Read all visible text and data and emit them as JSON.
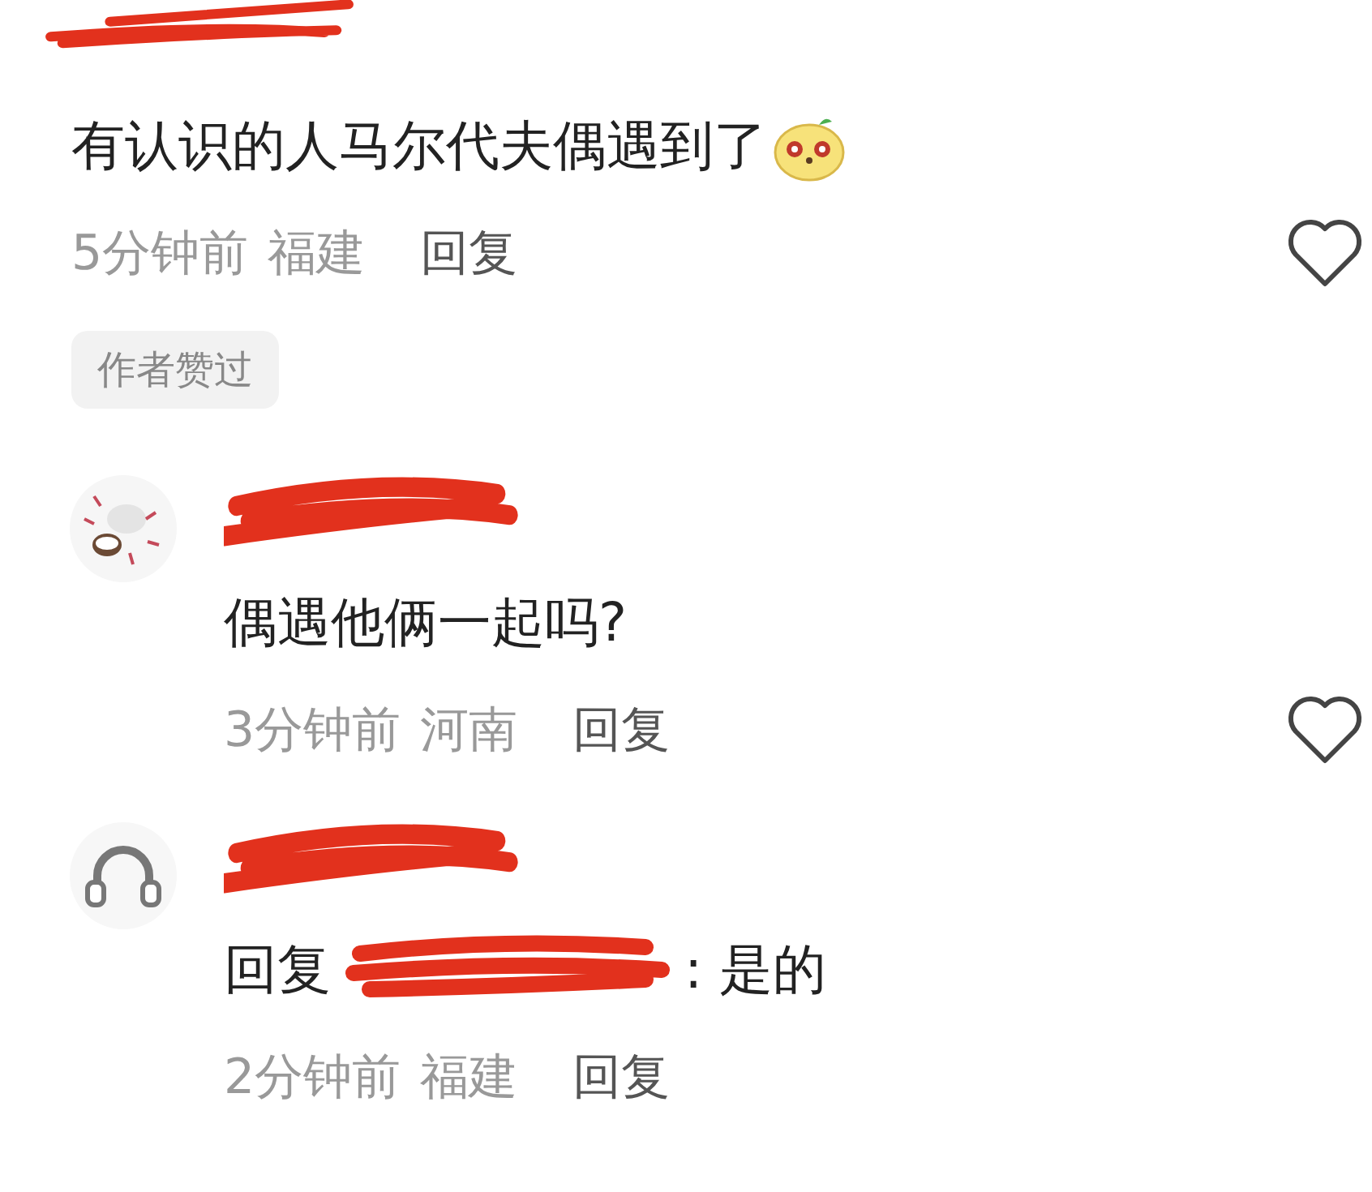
{
  "comments": [
    {
      "kind": "top",
      "username_redacted": true,
      "body": "有认识的人马尔代夫偶遇到了",
      "emoji": true,
      "time": "5分钟前",
      "location": "福建",
      "reply_action": "回复",
      "badge": "作者赞过",
      "like_heart": true
    },
    {
      "kind": "reply",
      "username_redacted": true,
      "body": "偶遇他俩一起吗?",
      "time": "3分钟前",
      "location": "河南",
      "reply_action": "回复",
      "like_heart": true
    },
    {
      "kind": "reply",
      "avatar": {
        "kind": "headphones"
      },
      "username_redacted": true,
      "reply_prefix": "回复",
      "reply_target_redacted": true,
      "body": ": 是的",
      "time": "2分钟前",
      "location": "福建",
      "reply_action": "回复"
    }
  ]
}
